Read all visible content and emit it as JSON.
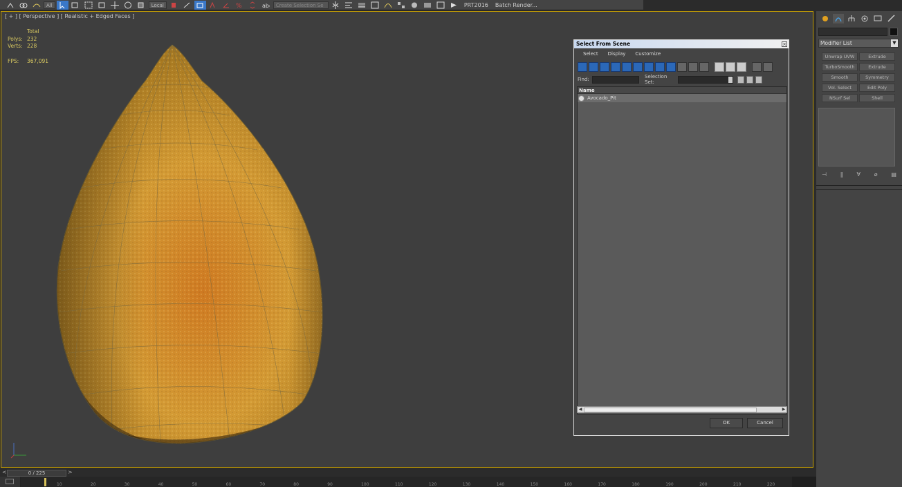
{
  "toolbar": {
    "selection_filter": "All",
    "ref_coord": "Local",
    "named_selection": "Create Selection Se",
    "prt_label": "PRT2016",
    "batch_render_label": "Batch Render..."
  },
  "viewport": {
    "label": "[ + ] [ Perspective ] [ Realistic + Edged Faces ]",
    "stats": {
      "total_label": "Total",
      "polys_label": "Polys:",
      "polys_value": "232",
      "verts_label": "Verts:",
      "verts_value": "228",
      "fps_label": "FPS:",
      "fps_value": "367,091"
    },
    "object": "avocado-pit-model"
  },
  "timeline": {
    "frame_display": "0 / 225",
    "ruler_ticks": [
      "10",
      "20",
      "30",
      "40",
      "50",
      "60",
      "70",
      "80",
      "90",
      "100",
      "110",
      "120",
      "130",
      "140",
      "150",
      "160",
      "170",
      "180",
      "190",
      "200",
      "210",
      "220"
    ]
  },
  "command_panel": {
    "modifier_list_label": "Modifier List",
    "modifier_buttons": [
      "Unwrap UVW",
      "Extrude",
      "TurboSmooth",
      "Extrude",
      "Smooth",
      "Symmetry",
      "Vol. Select",
      "Edit Poly",
      "NSurf Sel",
      "Shell"
    ]
  },
  "dialog": {
    "title": "Select From Scene",
    "menu": [
      "Select",
      "Display",
      "Customize"
    ],
    "find_label": "Find:",
    "selection_set_label": "Selection Set:",
    "column_header": "Name",
    "items": [
      "Avocado_Pit"
    ],
    "ok_label": "OK",
    "cancel_label": "Cancel"
  },
  "colors": {
    "viewport_border": "#c8a000",
    "stats_text": "#d8c860",
    "pit_light": "#d9a53a",
    "pit_dark": "#b86a1c",
    "dialog_icon_blue": "#2b68b8"
  }
}
